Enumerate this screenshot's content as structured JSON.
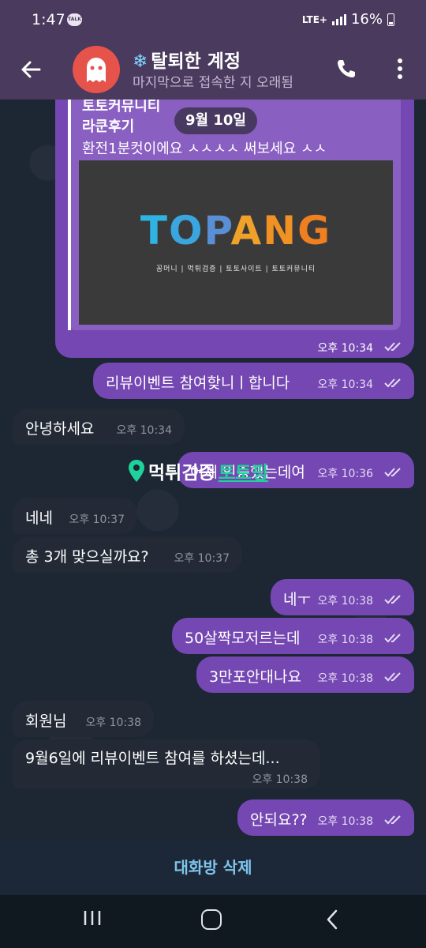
{
  "status_bar": {
    "time": "1:47",
    "notification": "TALK",
    "network": "LTE+",
    "battery": "16%"
  },
  "header": {
    "title": "탈퇴한 계정",
    "title_icon": "❄",
    "subtitle": "마지막으로 접속한 지 오래됨",
    "avatar_icon": "ghost-icon"
  },
  "date_pill": "9월 10일",
  "quoted_message": {
    "line1": "토토커뮤니티",
    "line2": "라쿤후기",
    "line3": "환전1분컷이에요 ㅅㅅㅅㅅ 써보세요 ㅅㅅ",
    "image_logo": "TOPANG",
    "image_tagline": "꽁머니 | 먹튀검증 | 토토사이트 | 토토커뮤니티",
    "time": "오후 10:34"
  },
  "messages": [
    {
      "id": "m1",
      "dir": "out",
      "text": "리뷰이벤트 참여핮니ㅣ합니다",
      "time": "오후 10:34"
    },
    {
      "id": "m2",
      "dir": "in",
      "text": "안녕하세요",
      "time": "오후 10:34"
    },
    {
      "id": "m3",
      "dir": "out",
      "text": "어제 인증했는데여",
      "time": "오후 10:36"
    },
    {
      "id": "m4",
      "dir": "in",
      "text": "네네",
      "time": "오후 10:37"
    },
    {
      "id": "m5",
      "dir": "in",
      "text": "총 3개 맞으실까요?",
      "time": "오후 10:37"
    },
    {
      "id": "m6",
      "dir": "out",
      "text": "네ㅜ",
      "time": "오후 10:38"
    },
    {
      "id": "m7",
      "dir": "out",
      "text": "50살짝모저르는데",
      "time": "오후 10:38"
    },
    {
      "id": "m8",
      "dir": "out",
      "text": "3만포안대나요",
      "time": "오후 10:38"
    },
    {
      "id": "m9",
      "dir": "in",
      "text": "회원님",
      "time": "오후 10:38"
    },
    {
      "id": "m10",
      "dir": "in",
      "text": "9월6일에 리뷰이벤트 참여를 하셨는데...",
      "time": "오후 10:38"
    },
    {
      "id": "m11",
      "dir": "out",
      "text": "안되요??",
      "time": "오후 10:38"
    }
  ],
  "watermark": {
    "part1": "먹튀검증",
    "part2": "토토핑"
  },
  "bottom_action": "대화방 삭제",
  "colors": {
    "outgoing": "#7447b2",
    "incoming": "#232a35",
    "header": "#4a3a5e",
    "link": "#7fc4ec"
  }
}
